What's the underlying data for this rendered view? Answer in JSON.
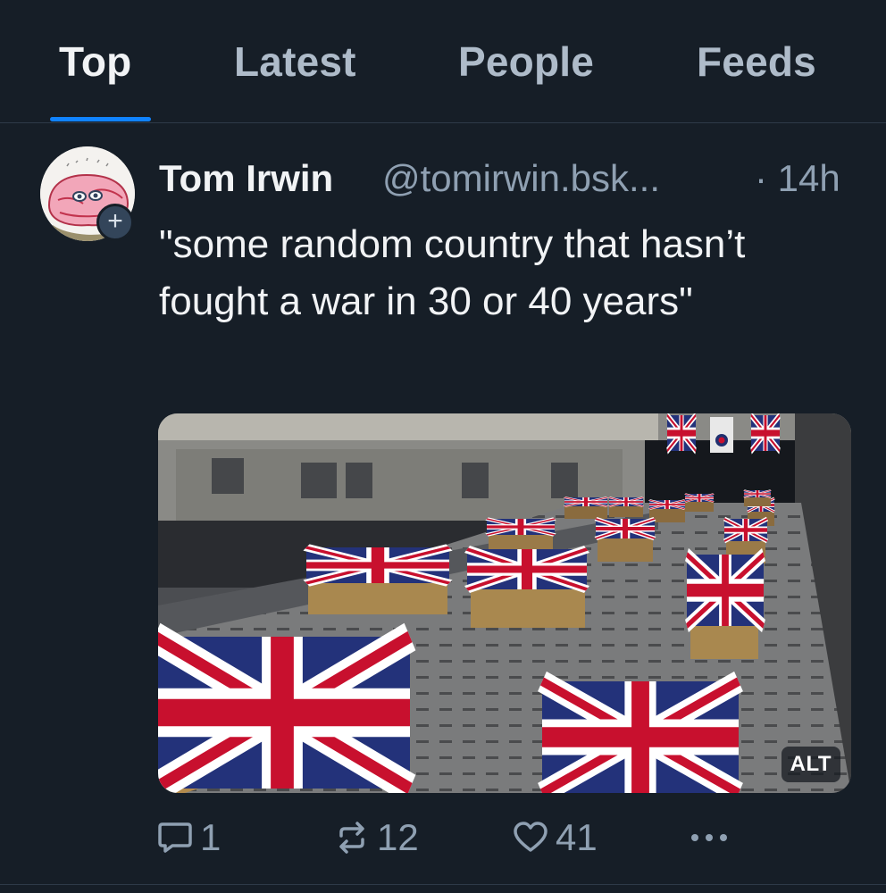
{
  "tabs": [
    {
      "label": "Top",
      "active": true
    },
    {
      "label": "Latest",
      "active": false
    },
    {
      "label": "People",
      "active": false
    },
    {
      "label": "Feeds",
      "active": false
    }
  ],
  "post": {
    "author_name": "Tom Irwin",
    "author_handle": "@tomirwin.bsk...",
    "time": "· 14h",
    "text": "\"some random country that hasn’t fought a war in 30 or 40 years\"",
    "follow_icon": "plus-icon",
    "media": {
      "alt_label": "ALT",
      "subject": "flag-draped coffins"
    },
    "actions": {
      "reply_count": "1",
      "repost_count": "12",
      "like_count": "41"
    }
  },
  "colors": {
    "background": "#161e27",
    "accent": "#1083fe",
    "muted_text": "#8fa0b2",
    "primary_text": "#f1f3f5"
  }
}
